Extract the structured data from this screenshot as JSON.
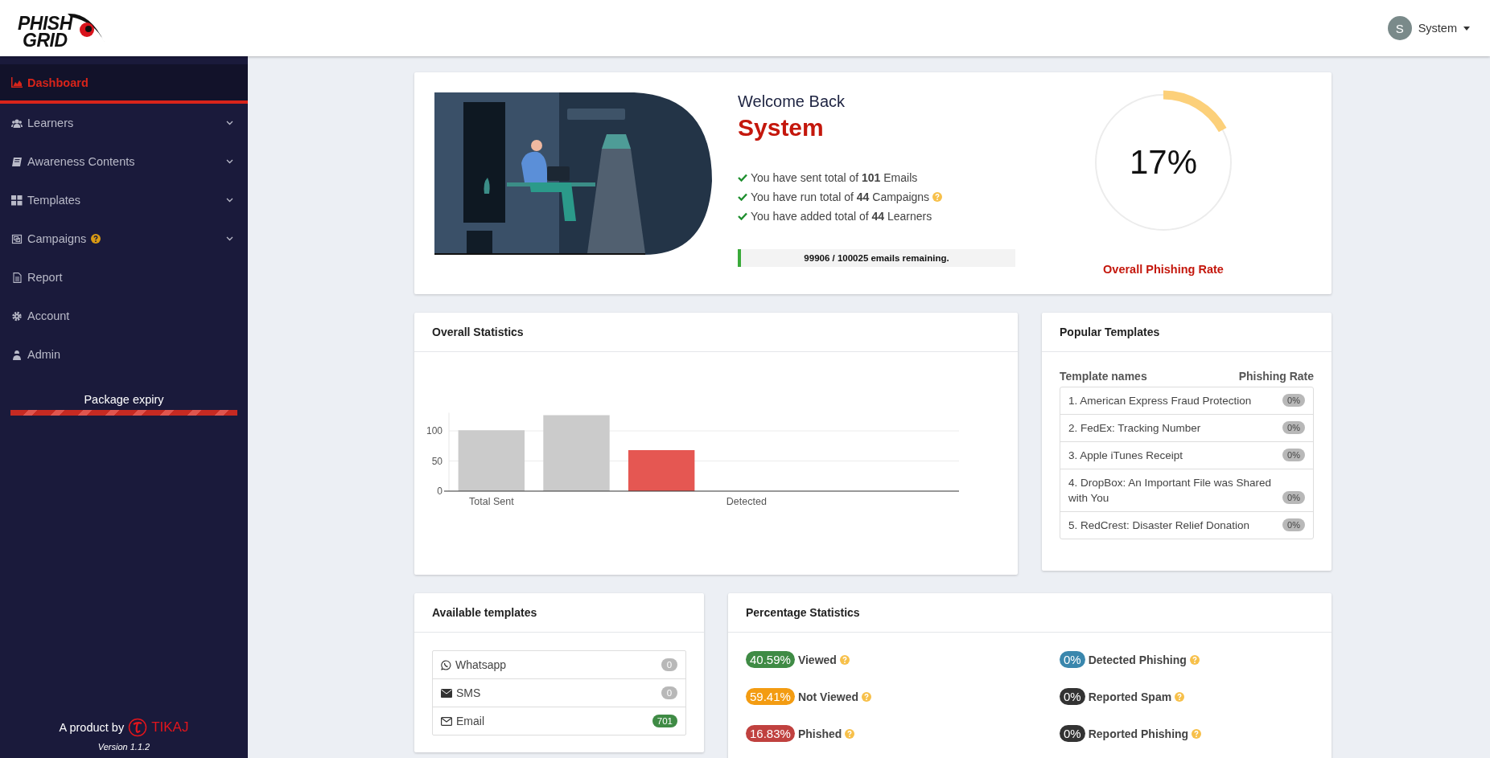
{
  "header": {
    "logo": {
      "line_1": "PHISH",
      "line_2": "GRID"
    },
    "user": {
      "avatar_initial": "S",
      "name": "System"
    }
  },
  "sidebar": {
    "items": [
      {
        "label": "Dashboard",
        "selected": true,
        "expandable": false,
        "help": false
      },
      {
        "label": "Learners",
        "selected": false,
        "expandable": true,
        "help": false
      },
      {
        "label": "Awareness Contents",
        "selected": false,
        "expandable": true,
        "help": false
      },
      {
        "label": "Templates",
        "selected": false,
        "expandable": true,
        "help": false
      },
      {
        "label": "Campaigns",
        "selected": false,
        "expandable": true,
        "help": true
      },
      {
        "label": "Report",
        "selected": false,
        "expandable": false,
        "help": false
      },
      {
        "label": "Account",
        "selected": false,
        "expandable": false,
        "help": false
      },
      {
        "label": "Admin",
        "selected": false,
        "expandable": false,
        "help": false
      }
    ],
    "package_expiry": {
      "label": "Package expiry",
      "level": 1
    },
    "footer": {
      "product_by": "A product by",
      "brand": "TIKAJ",
      "version": "Version 1.1.2"
    }
  },
  "welcome": {
    "greeting": "Welcome Back",
    "name": "System",
    "facts": [
      {
        "text": "You have sent total of **101** Emails",
        "help": false
      },
      {
        "text": "You have run total of **44** Campaigns",
        "help": true
      },
      {
        "text": "You have added total of **44** Learners",
        "help": false
      }
    ],
    "quota": {
      "text": "99906 / 100025 emails remaining.",
      "level": 0.0012
    },
    "phishing_rate": {
      "value": "17%",
      "level": 0.17,
      "label": "Overall Phishing Rate"
    }
  },
  "overall_statistics": {
    "title": "Overall Statistics",
    "chart_data": {
      "type": "bar",
      "categories": [
        "Total Sent",
        null,
        null,
        "Detected",
        null,
        null
      ],
      "ylim": [
        0,
        130
      ],
      "yticks": [
        0,
        50,
        100
      ],
      "values": [
        101,
        126,
        68,
        null,
        null,
        null
      ],
      "colors": [
        "#cbcbcb",
        "#cbcbcb",
        "#e55752",
        null,
        null,
        null
      ]
    }
  },
  "popular_templates": {
    "title": "Popular Templates",
    "columns": [
      "Template names",
      "Phishing Rate"
    ],
    "rows": [
      {
        "name": "1. American Express Fraud Protection",
        "rate": "0%"
      },
      {
        "name": "2. FedEx: Tracking Number",
        "rate": "0%"
      },
      {
        "name": "3. Apple iTunes Receipt",
        "rate": "0%"
      },
      {
        "name": "4. DropBox: An Important File was Shared with You",
        "rate": "0%"
      },
      {
        "name": "5. RedCrest: Disaster Relief Donation",
        "rate": "0%"
      }
    ]
  },
  "available_templates": {
    "title": "Available templates",
    "items": [
      {
        "label": "Whatsapp",
        "count": "0",
        "color": "#b8b8b8"
      },
      {
        "label": "SMS",
        "count": "0",
        "color": "#b8b8b8"
      },
      {
        "label": "Email",
        "count": "701",
        "color": "#3f8b45"
      }
    ]
  },
  "percentage_statistics": {
    "title": "Percentage Statistics",
    "items": [
      {
        "value": "40.59%",
        "label": "Viewed",
        "color": "#3f8b45"
      },
      {
        "value": "0%",
        "label": "Detected Phishing",
        "color": "#3a87ad"
      },
      {
        "value": "59.41%",
        "label": "Not Viewed",
        "color": "#f39c12"
      },
      {
        "value": "0%",
        "label": "Reported Spam",
        "color": "#333333"
      },
      {
        "value": "16.83%",
        "label": "Phished",
        "color": "#c0413f"
      },
      {
        "value": "0%",
        "label": "Reported Phishing",
        "color": "#333333"
      }
    ]
  }
}
